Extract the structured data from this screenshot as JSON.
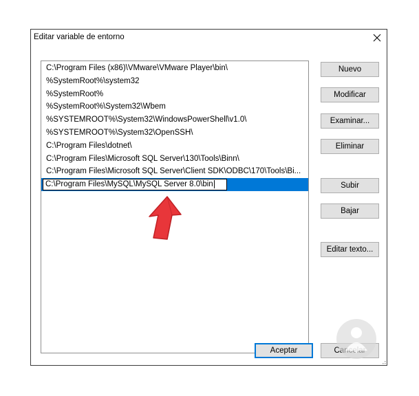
{
  "dialog": {
    "title": "Editar variable de entorno",
    "close_glyph": "✕"
  },
  "paths": [
    "C:\\Program Files (x86)\\VMware\\VMware Player\\bin\\",
    "%SystemRoot%\\system32",
    "%SystemRoot%",
    "%SystemRoot%\\System32\\Wbem",
    "%SYSTEMROOT%\\System32\\WindowsPowerShell\\v1.0\\",
    "%SYSTEMROOT%\\System32\\OpenSSH\\",
    "C:\\Program Files\\dotnet\\",
    "C:\\Program Files\\Microsoft SQL Server\\130\\Tools\\Binn\\",
    "C:\\Program Files\\Microsoft SQL Server\\Client SDK\\ODBC\\170\\Tools\\Bi..."
  ],
  "editing": {
    "value": "C:\\Program Files\\MySQL\\MySQL Server 8.0\\bin"
  },
  "buttons": {
    "new": "Nuevo",
    "modify": "Modificar",
    "browse": "Examinar...",
    "delete": "Eliminar",
    "up": "Subir",
    "down": "Bajar",
    "edit_text": "Editar texto...",
    "ok": "Aceptar",
    "cancel": "Cancelar"
  },
  "colors": {
    "selection": "#0078d7",
    "arrow": "#e8363a",
    "button_face": "#e1e1e1"
  }
}
